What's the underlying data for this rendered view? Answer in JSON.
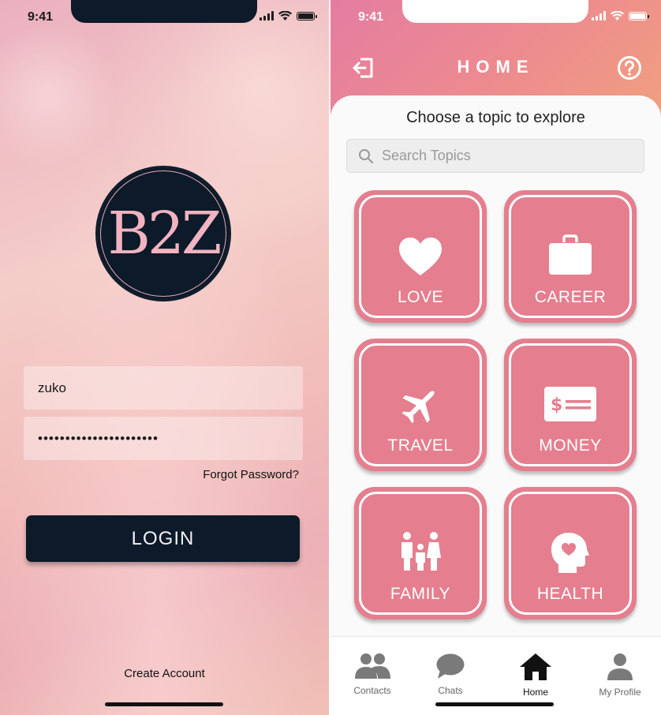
{
  "status_bar": {
    "time": "9:41"
  },
  "login": {
    "logo_text": "B2Z",
    "username_value": "zuko",
    "password_value": "••••••••••••••••••••••",
    "forgot_password": "Forgot Password?",
    "login_button": "LOGIN",
    "create_account": "Create Account"
  },
  "home": {
    "title": "HOME",
    "subtitle": "Choose a topic to explore",
    "search_placeholder": "Search Topics",
    "topics": [
      {
        "label": "LOVE",
        "icon": "heart-icon"
      },
      {
        "label": "CAREER",
        "icon": "briefcase-icon"
      },
      {
        "label": "TRAVEL",
        "icon": "airplane-icon"
      },
      {
        "label": "MONEY",
        "icon": "money-icon"
      },
      {
        "label": "FAMILY",
        "icon": "family-icon"
      },
      {
        "label": "HEALTH",
        "icon": "head-heart-icon"
      }
    ],
    "tabs": [
      {
        "label": "Contacts",
        "icon": "contacts-icon"
      },
      {
        "label": "Chats",
        "icon": "chat-icon"
      },
      {
        "label": "Home",
        "icon": "home-icon",
        "active": true
      },
      {
        "label": "My Profile",
        "icon": "profile-icon"
      }
    ]
  },
  "colors": {
    "tile": "#e57e8e",
    "dark": "#0c1a2a",
    "header_start": "#e47da1",
    "header_end": "#f1a07e"
  }
}
